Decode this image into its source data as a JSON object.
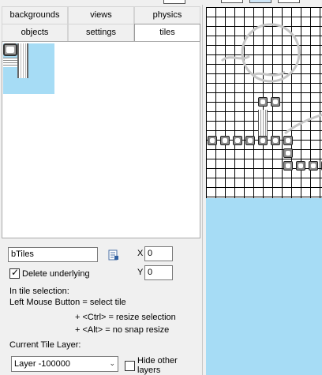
{
  "tabs_row1": [
    "backgrounds",
    "views",
    "physics"
  ],
  "tabs_row2": [
    "objects",
    "settings",
    "tiles"
  ],
  "active_tab": "tiles",
  "tileset": {
    "value": "bTiles"
  },
  "x": {
    "label": "X",
    "value": "0"
  },
  "y": {
    "label": "Y",
    "value": "0"
  },
  "delete_underlying": {
    "label": "Delete underlying",
    "checked": true
  },
  "help": {
    "line1": "In tile selection:",
    "line2": "Left Mouse Button  = select tile",
    "line3": "+ <Ctrl> = resize selection",
    "line4": "+ <Alt>  =  no snap resize"
  },
  "layer": {
    "label": "Current Tile Layer:",
    "selected": "Layer -100000",
    "hide_label": "Hide other layers",
    "hide_checked": false
  },
  "colors": {
    "water": "#a6dcf5",
    "grid": "#000000"
  },
  "icons": {
    "pick_tileset": "document-list-icon",
    "dropdown": "chevron-down-icon"
  }
}
